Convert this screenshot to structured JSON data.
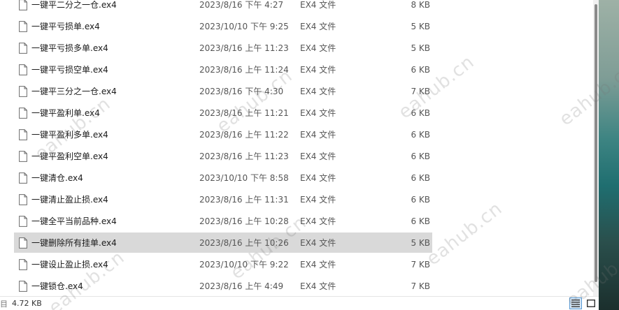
{
  "files": [
    {
      "name": "一键平二分之一仓.ex4",
      "date": "2023/8/16 下午 4:27",
      "type": "EX4 文件",
      "size": "8 KB"
    },
    {
      "name": "一键平亏损单.ex4",
      "date": "2023/10/10 下午 9:25",
      "type": "EX4 文件",
      "size": "5 KB"
    },
    {
      "name": "一键平亏损多单.ex4",
      "date": "2023/8/16 上午 11:23",
      "type": "EX4 文件",
      "size": "5 KB"
    },
    {
      "name": "一键平亏损空单.ex4",
      "date": "2023/8/16 上午 11:24",
      "type": "EX4 文件",
      "size": "6 KB"
    },
    {
      "name": "一键平三分之一仓.ex4",
      "date": "2023/8/16 下午 4:30",
      "type": "EX4 文件",
      "size": "7 KB"
    },
    {
      "name": "一键平盈利单.ex4",
      "date": "2023/8/16 上午 11:21",
      "type": "EX4 文件",
      "size": "6 KB"
    },
    {
      "name": "一键平盈利多单.ex4",
      "date": "2023/8/16 上午 11:22",
      "type": "EX4 文件",
      "size": "6 KB"
    },
    {
      "name": "一键平盈利空单.ex4",
      "date": "2023/8/16 上午 11:23",
      "type": "EX4 文件",
      "size": "6 KB"
    },
    {
      "name": "一键清仓.ex4",
      "date": "2023/10/10 下午 8:58",
      "type": "EX4 文件",
      "size": "6 KB"
    },
    {
      "name": "一键清止盈止损.ex4",
      "date": "2023/8/16 上午 11:31",
      "type": "EX4 文件",
      "size": "6 KB"
    },
    {
      "name": "一键全平当前品种.ex4",
      "date": "2023/8/16 上午 10:28",
      "type": "EX4 文件",
      "size": "6 KB"
    },
    {
      "name": "一键删除所有挂单.ex4",
      "date": "2023/8/16 上午 10:26",
      "type": "EX4 文件",
      "size": "5 KB",
      "selected": true
    },
    {
      "name": "一键设止盈止损.ex4",
      "date": "2023/10/10 下午 9:22",
      "type": "EX4 文件",
      "size": "7 KB"
    },
    {
      "name": "一键锁仓.ex4",
      "date": "2023/8/16 上午 4:49",
      "type": "EX4 文件",
      "size": "7 KB"
    }
  ],
  "status": {
    "separator": "目",
    "selection_size": "4.72 KB"
  },
  "watermark": {
    "text": "eahub.cn"
  },
  "icons": {
    "file": "file-icon",
    "details_view": "details-view-icon",
    "large_icons_view": "large-icons-view-icon"
  },
  "colors": {
    "selected_row": "#d9d9d9",
    "active_view_button": "#d6e6f5"
  }
}
